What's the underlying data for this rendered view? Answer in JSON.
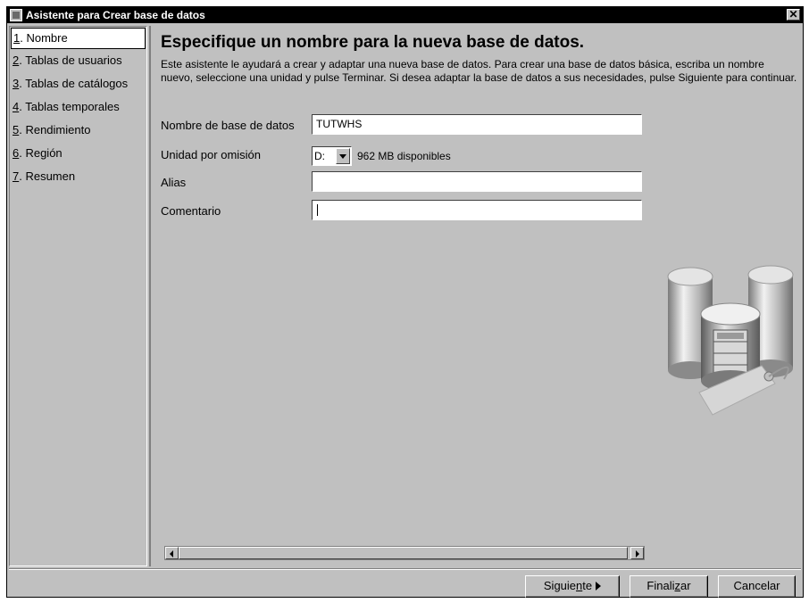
{
  "window": {
    "title": "Asistente para Crear base de datos"
  },
  "nav": {
    "items": [
      {
        "num": "1",
        "label": ". Nombre",
        "selected": true
      },
      {
        "num": "2",
        "label": ". Tablas de usuarios"
      },
      {
        "num": "3",
        "label": ". Tablas de catálogos"
      },
      {
        "num": "4",
        "label": ". Tablas temporales"
      },
      {
        "num": "5",
        "label": ". Rendimiento"
      },
      {
        "num": "6",
        "label": ". Región"
      },
      {
        "num": "7",
        "label": ". Resumen"
      }
    ]
  },
  "main": {
    "heading": "Especifique un nombre para la nueva base de datos.",
    "intro": "Este asistente le ayudará a crear y adaptar una nueva base de datos. Para crear una base de datos básica, escriba un nombre nuevo, seleccione una unidad y pulse Terminar. Si desea adaptar la base de datos a sus necesidades, pulse Siguiente para continuar.",
    "form": {
      "db_name_label": "Nombre de base de datos",
      "db_name_value": "TUTWHS",
      "drive_label": "Unidad por omisión",
      "drive_value": "D:",
      "free_space": "962 MB disponibles",
      "alias_label": "Alias",
      "alias_value": "",
      "comment_label": "Comentario",
      "comment_value": ""
    },
    "illustration": "database-cylinders-with-tag"
  },
  "buttons": {
    "next_pre": "Siguie",
    "next_u": "n",
    "next_post": "te",
    "finish_pre": "Finali",
    "finish_u": "z",
    "finish_post": "ar",
    "cancel": "Cancelar"
  },
  "colors": {
    "face": "#c0c0c0",
    "titlebar": "#000000",
    "field": "#ffffff"
  }
}
